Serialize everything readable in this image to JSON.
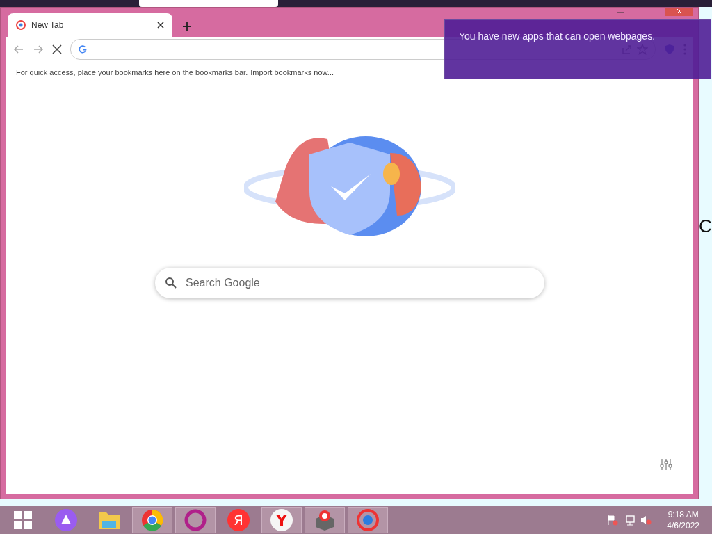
{
  "browser": {
    "tabs": [
      {
        "title": "New Tab",
        "selected": true
      }
    ],
    "bookmarks_bar": {
      "message": "For quick access, place your bookmarks here on the bookmarks bar.",
      "link": "Import bookmarks now..."
    },
    "search": {
      "placeholder": "Search Google"
    }
  },
  "notification": {
    "message": "You have new apps that can open webpages."
  },
  "background_text": "C",
  "taskbar": {
    "apps": [
      {
        "kind": "windows",
        "selected": false
      },
      {
        "kind": "assistant",
        "selected": false
      },
      {
        "kind": "folder",
        "selected": false
      },
      {
        "kind": "wheel",
        "selected": true
      },
      {
        "kind": "ring",
        "selected": true
      },
      {
        "kind": "letter",
        "glyph": "Я",
        "selected": false
      },
      {
        "kind": "letter-circle",
        "glyph": "Y",
        "selected": true
      },
      {
        "kind": "box",
        "selected": true
      },
      {
        "kind": "swirl",
        "selected": true
      }
    ],
    "time": "9:18 AM",
    "date": "4/6/2022"
  }
}
